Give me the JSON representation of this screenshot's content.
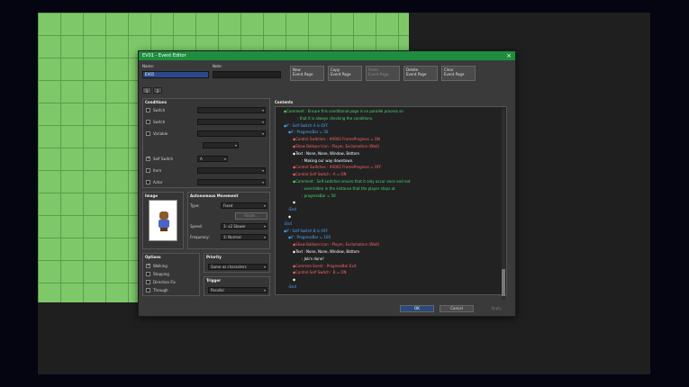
{
  "window": {
    "title": "EV01 - Event Editor"
  },
  "header": {
    "name_label": "Name:",
    "name_value": "EV01",
    "note_label": "Note:",
    "note_value": "",
    "buttons": [
      {
        "label": "New\nEvent Page",
        "enabled": true
      },
      {
        "label": "Copy\nEvent Page",
        "enabled": true
      },
      {
        "label": "Paste\nEvent Page",
        "enabled": false
      },
      {
        "label": "Delete\nEvent Page",
        "enabled": true
      },
      {
        "label": "Clear\nEvent Page",
        "enabled": true
      }
    ]
  },
  "tabs": [
    "1",
    "2"
  ],
  "conditions": {
    "title": "Conditions",
    "items": [
      {
        "label": "Switch",
        "checked": false
      },
      {
        "label": "Switch",
        "checked": false
      },
      {
        "label": "Variable",
        "checked": false
      },
      {
        "label": "Self Switch",
        "checked": true,
        "value": "A"
      },
      {
        "label": "Item",
        "checked": false
      },
      {
        "label": "Actor",
        "checked": false
      }
    ]
  },
  "image": {
    "title": "Image"
  },
  "movement": {
    "title": "Autonomous Movement",
    "type_label": "Type:",
    "type_value": "Fixed",
    "route_button": "Route...",
    "speed_label": "Speed:",
    "speed_value": "3: x2 Slower",
    "freq_label": "Frequency:",
    "freq_value": "3: Normal"
  },
  "options": {
    "title": "Options",
    "items": [
      {
        "label": "Walking",
        "checked": true
      },
      {
        "label": "Stepping",
        "checked": false
      },
      {
        "label": "Direction Fix",
        "checked": false
      },
      {
        "label": "Through",
        "checked": false
      }
    ]
  },
  "priority": {
    "title": "Priority",
    "value": "Same as characters"
  },
  "trigger": {
    "title": "Trigger",
    "value": "Parallel"
  },
  "contents": {
    "title": "Contents",
    "lines": [
      {
        "text": "◆Comment : Ensure this conditional page is on parallel process so",
        "color": "#4cd96a",
        "indent": 1
      },
      {
        "text": ": that it is always checking the conditions.",
        "color": "#4cd96a",
        "indent": 4
      },
      {
        "text": "◆If : Self Switch A is OFF",
        "color": "#4aa6ff",
        "indent": 1
      },
      {
        "text": "◆If : ProgressBar = 50",
        "color": "#4aa6ff",
        "indent": 2
      },
      {
        "text": "◆Control Switches : #0002 FrameProgress = ON",
        "color": "#ff6464",
        "indent": 3
      },
      {
        "text": "◆Show Balloon Icon : Player, Exclamation (Wait)",
        "color": "#ff6464",
        "indent": 3
      },
      {
        "text": "◆Text : None, None, Window, Bottom",
        "color": "#ffffff",
        "indent": 3
      },
      {
        "text": ": Making our way downtown.",
        "color": "#ffffff",
        "indent": 5
      },
      {
        "text": "◆Control Switches : #0002 FrameProgress = OFF",
        "color": "#ff6464",
        "indent": 3
      },
      {
        "text": "◆Control Self Switch : A = ON",
        "color": "#ff6464",
        "indent": 3
      },
      {
        "text": "◆Comment : Self switches ensure that it only occur once and not",
        "color": "#4cd96a",
        "indent": 3
      },
      {
        "text": ": overridden in the instance that the player stays at",
        "color": "#4cd96a",
        "indent": 5
      },
      {
        "text": ": progressBar = 50",
        "color": "#4cd96a",
        "indent": 5
      },
      {
        "text": "◆",
        "color": "#ffffff",
        "indent": 3
      },
      {
        "text": ":End",
        "color": "#4aa6ff",
        "indent": 2
      },
      {
        "text": "◆",
        "color": "#ffffff",
        "indent": 2
      },
      {
        "text": ":End",
        "color": "#4aa6ff",
        "indent": 1
      },
      {
        "text": "◆If : Self Switch B is OFF",
        "color": "#4aa6ff",
        "indent": 1
      },
      {
        "text": "◆If : ProgressBar = 100",
        "color": "#4aa6ff",
        "indent": 2
      },
      {
        "text": "◆Show Balloon Icon : Player, Exclamation (Wait)",
        "color": "#ff6464",
        "indent": 3
      },
      {
        "text": "◆Text : None, None, Window, Bottom",
        "color": "#ffffff",
        "indent": 3
      },
      {
        "text": ": Job's done!",
        "color": "#ffffff",
        "indent": 5
      },
      {
        "text": "◆Common Event : ProgressBar Exit",
        "color": "#ff6464",
        "indent": 3
      },
      {
        "text": "◆Control Self Switch : B = ON",
        "color": "#ff6464",
        "indent": 3
      },
      {
        "text": "◆",
        "color": "#ffffff",
        "indent": 3
      },
      {
        "text": ":End",
        "color": "#4aa6ff",
        "indent": 2
      }
    ]
  },
  "footer": {
    "ok": "OK",
    "cancel": "Cancel",
    "apply": "Apply"
  }
}
